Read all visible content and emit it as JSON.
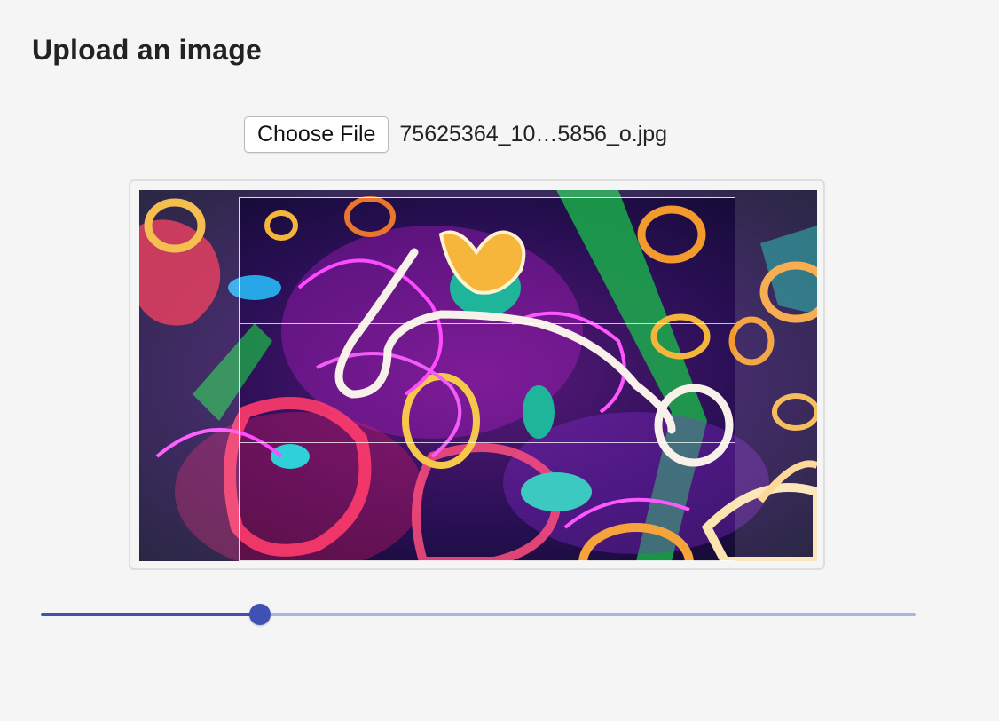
{
  "page": {
    "title": "Upload an image"
  },
  "file_input": {
    "button_label": "Choose File",
    "file_name": "75625364_10…5856_o.jpg"
  },
  "crop_grid": {
    "rows": 3,
    "columns": 3
  },
  "zoom_slider": {
    "value": 0.25,
    "fill_color": "#3f51b5",
    "track_color": "#a9b5dc"
  }
}
